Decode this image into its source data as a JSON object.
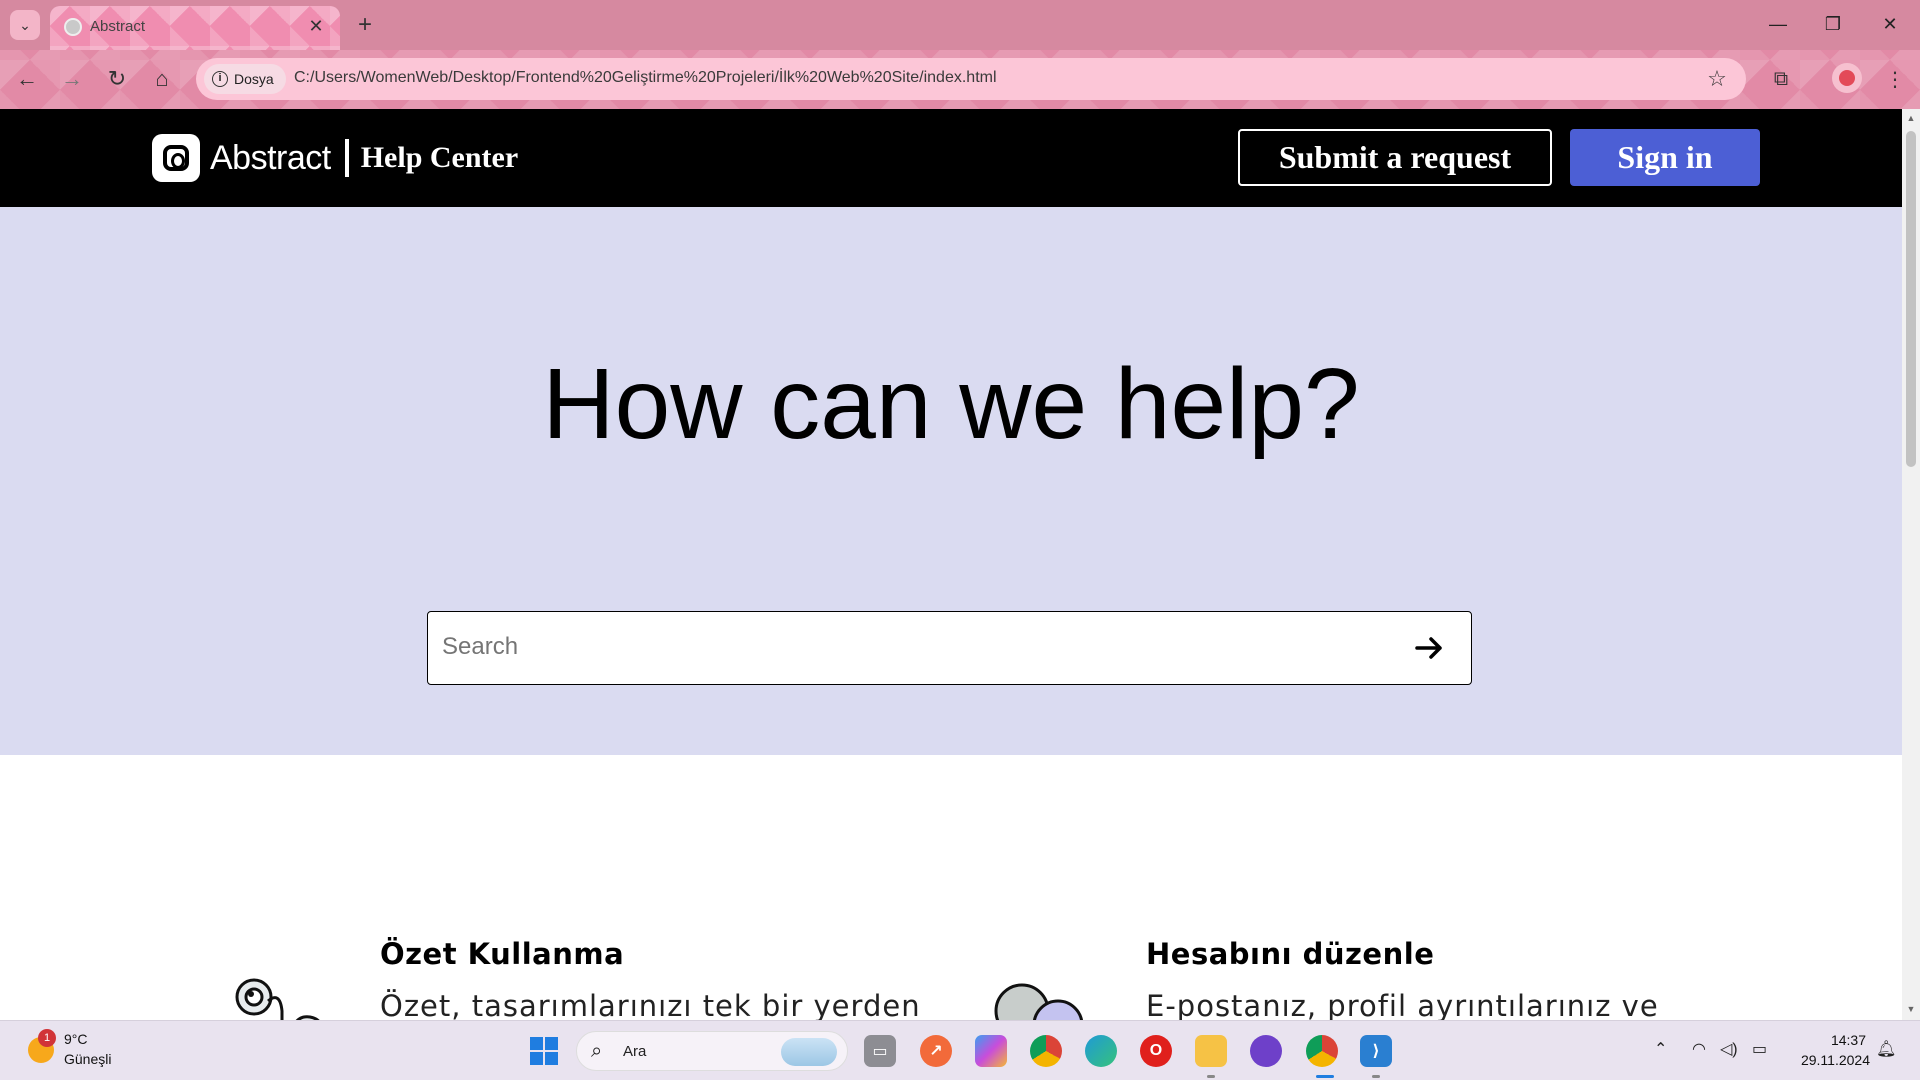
{
  "browser": {
    "tab_title": "Abstract",
    "chip_label": "Dosya",
    "url": "C:/Users/WomenWeb/Desktop/Frontend%20Geliştirme%20Projeleri/İlk%20Web%20Site/index.html",
    "accent_color": "#e28aa6"
  },
  "header": {
    "brand_name": "Abstract",
    "brand_sub": "Help Center",
    "submit_label": "Submit a request",
    "signin_label": "Sign in",
    "signin_color": "#4c5fd5"
  },
  "hero": {
    "title": "How can we help?",
    "search_placeholder": "Search",
    "background": "#dadbf1"
  },
  "cards": [
    {
      "title": "Özet Kullanma",
      "desc": "Özet, tasarımlarınızı tek bir yerden",
      "icon": "binoculars-illustration"
    },
    {
      "title": "Hesabını düzenle",
      "desc": "E-postanız, profil ayrıntılarınız ve",
      "icon": "avatars-illustration"
    }
  ],
  "taskbar": {
    "weather_temp": "9°C",
    "weather_desc": "Güneşli",
    "weather_badge": "1",
    "search_text": "Ara",
    "time": "14:37",
    "date": "29.11.2024"
  }
}
